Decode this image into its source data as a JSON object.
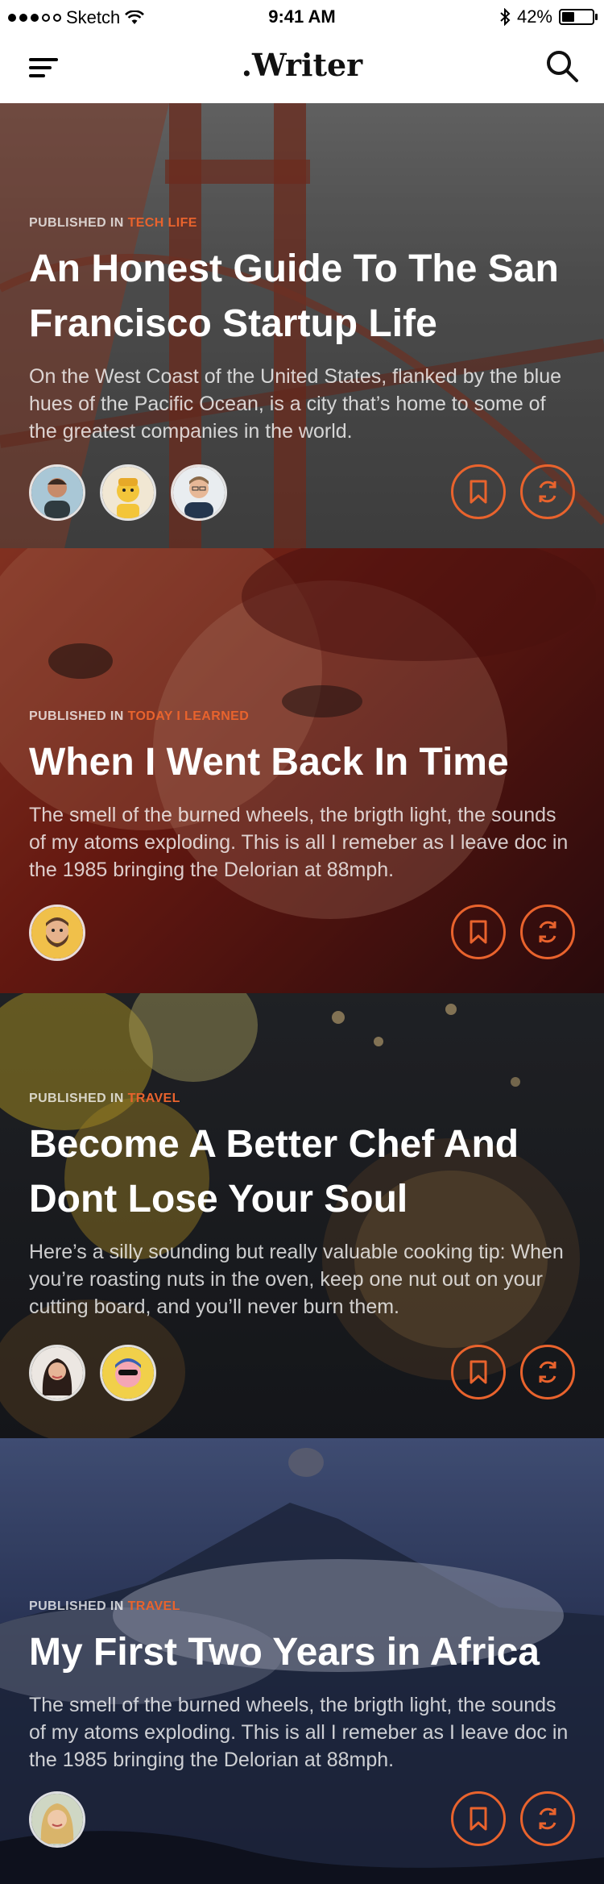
{
  "status": {
    "carrier": "Sketch",
    "time": "9:41 AM",
    "battery": "42%",
    "battery_level": 0.42
  },
  "nav": {
    "brand": ".Writer"
  },
  "colors": {
    "accent": "#e9632d"
  },
  "icons": {
    "menu": "hamburger-icon",
    "search": "magnifier-icon",
    "bookmark": "bookmark-icon",
    "share": "refresh-icon"
  },
  "posts": [
    {
      "published_in": "PUBLISHED IN",
      "category": "TECH LIFE",
      "title": "An Honest Guide To The San Francisco Startup Life",
      "excerpt": "On the West Coast of the United States, flanked by the blue hues of the Pacific Ocean, is a city that’s home to some of the greatest companies in the world."
    },
    {
      "published_in": "PUBLISHED IN",
      "category": "TODAY I LEARNED",
      "title": "When I Went Back In Time",
      "excerpt": "The smell of the burned wheels, the brigth light, the sounds of my atoms exploding. This is all I remeber as I leave doc in the 1985 bringing the Delorian at 88mph."
    },
    {
      "published_in": "PUBLISHED IN",
      "category": "TRAVEL",
      "title": "Become A Better Chef And Dont Lose Your Soul",
      "excerpt": "Here’s a silly sounding but really valuable cooking tip: When you’re roasting nuts in the oven, keep one nut out on your cutting board, and you’ll never burn them."
    },
    {
      "published_in": "PUBLISHED IN",
      "category": "TRAVEL",
      "title": "My First Two Years in Africa",
      "excerpt": "The smell of the burned wheels, the brigth light, the sounds of my atoms exploding. This is all I remeber as I leave doc in the 1985 bringing the Delorian at 88mph."
    }
  ]
}
